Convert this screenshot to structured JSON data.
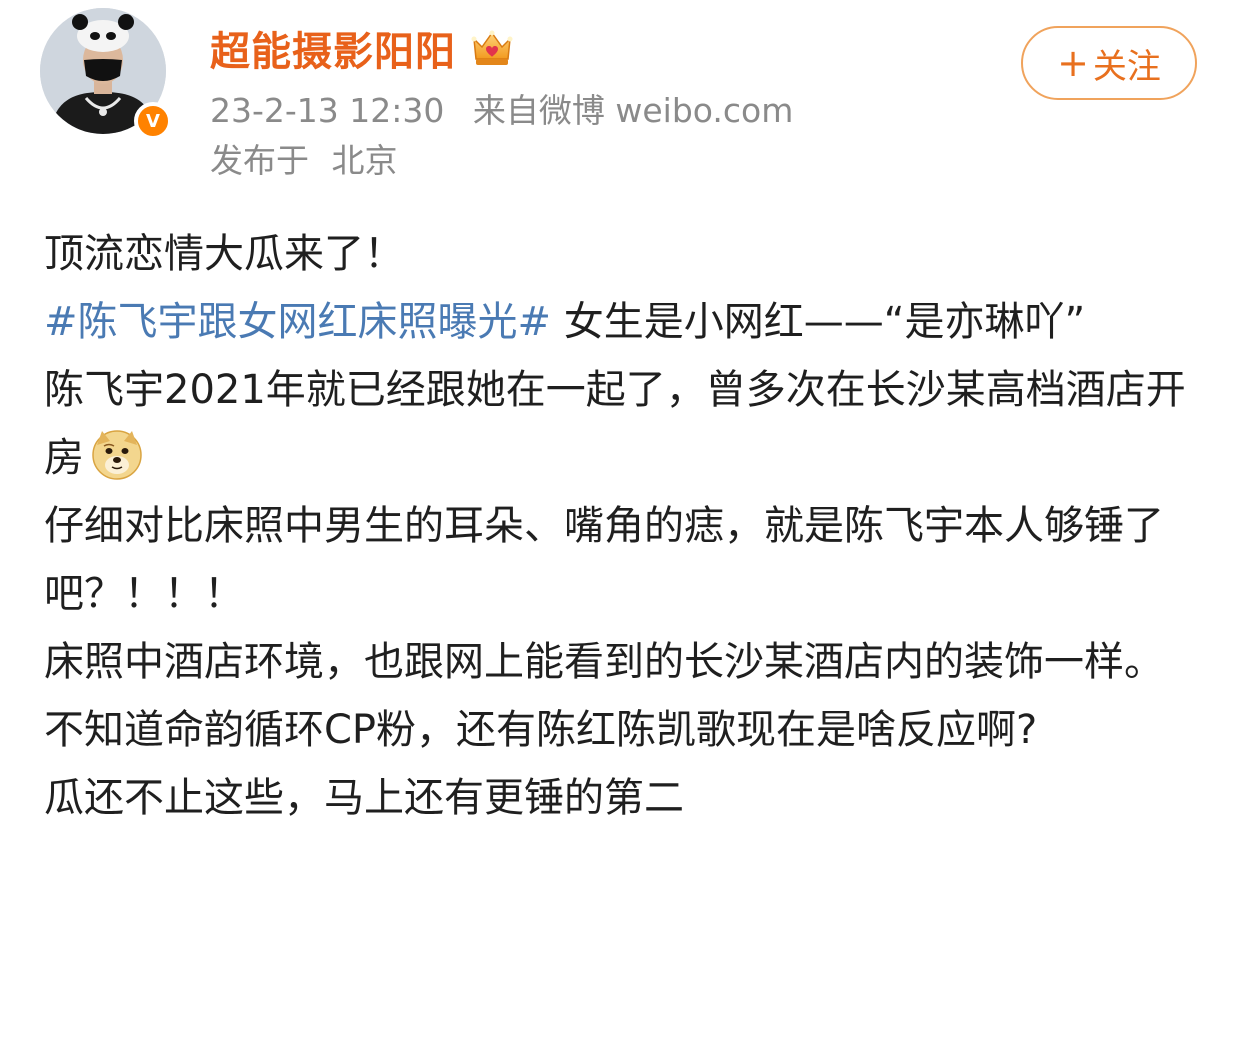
{
  "post": {
    "author": {
      "name": "超能摄影阳阳",
      "avatar_icon": "user-avatar",
      "verified_badge": "V",
      "badge_icon": "crown-badge-icon"
    },
    "meta": {
      "time": "23-2-13 12:30",
      "source": "来自微博 weibo.com",
      "location_prefix": "发布于",
      "location": "北京"
    },
    "follow_button": {
      "plus": "+",
      "label": "关注"
    },
    "content": {
      "line1": "顶流恋情大瓜来了！",
      "hashtag": "#陈飞宇跟女网红床照曝光#",
      "line2_rest": " 女生是小网红——“是亦琳吖”",
      "line3": "陈飞宇2021年就已经跟她在一起了，曾多次在长沙某高档酒店开房",
      "emoji_icon": "doge-emoji-icon",
      "line4": "仔细对比床照中男生的耳朵、嘴角的痣，就是陈飞宇本人够锤了吧？！！！",
      "line5": "床照中酒店环境，也跟网上能看到的长沙某酒店内的装饰一样。",
      "line6": "不知道命韵循环CP粉，还有陈红陈凯歌现在是啥反应啊?",
      "line7": "瓜还不止这些，马上还有更锤的第二"
    },
    "colors": {
      "username": "#e8611a",
      "hashtag": "#4a7ab3",
      "meta": "#8a8a8a",
      "follow_border": "#f0a35c",
      "follow_text": "#e8701e",
      "verified": "#ff8200"
    }
  }
}
